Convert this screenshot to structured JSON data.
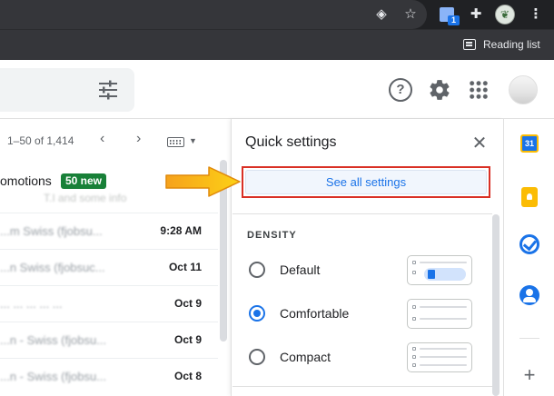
{
  "browser": {
    "reading_list_label": "Reading list",
    "extension_badge": "1",
    "icons": [
      "eye-icon",
      "star-icon",
      "extension-icon",
      "puzzle-icon",
      "profile-icon",
      "kebab-menu-icon"
    ]
  },
  "gmail": {
    "pagination": "1–50 of 1,414",
    "promotions_tab_label": "omotions",
    "promotions_new_badge": "50 new",
    "promotions_preview": "T.I and some info",
    "rows": [
      {
        "sender": "...m Swiss (fjobsu...",
        "date": "9:28 AM"
      },
      {
        "sender": "...n Swiss (fjobsuc...",
        "date": "Oct 11"
      },
      {
        "sender": "...  ...  ...  ...  ...",
        "date": "Oct 9"
      },
      {
        "sender": "...n - Swiss (fjobsu...",
        "date": "Oct 9"
      },
      {
        "sender": "...n - Swiss (fjobsu...",
        "date": "Oct 8"
      }
    ]
  },
  "quick_settings": {
    "title": "Quick settings",
    "see_all_label": "See all settings",
    "density_title": "DENSITY",
    "density_options": [
      {
        "label": "Default",
        "selected": false
      },
      {
        "label": "Comfortable",
        "selected": true
      },
      {
        "label": "Compact",
        "selected": false
      }
    ]
  },
  "side_panel": {
    "calendar_label": "31"
  },
  "colors": {
    "accent": "#1a73e8",
    "highlight_border": "#d93025",
    "new_badge": "#188038",
    "annotation_arrow": "#f9a825"
  }
}
